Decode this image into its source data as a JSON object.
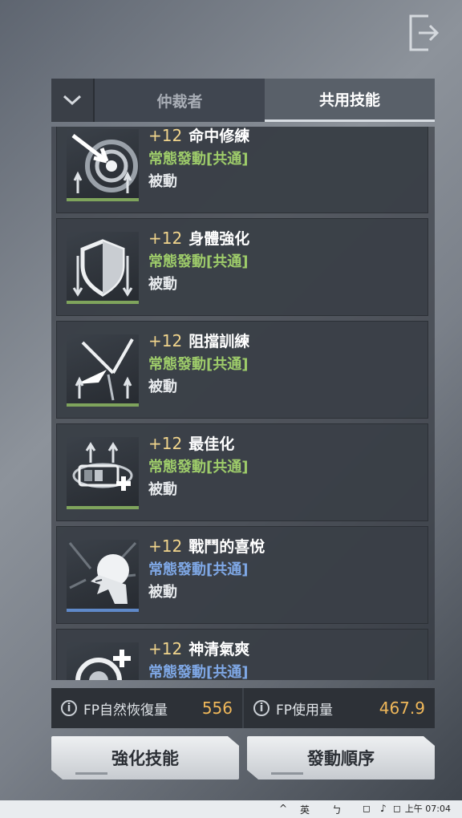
{
  "header": {
    "exit_icon": "exit-icon"
  },
  "tabs": {
    "dropdown_icon": "chevron-down-icon",
    "items": [
      {
        "label": "仲裁者",
        "active": false
      },
      {
        "label": "共用技能",
        "active": true
      }
    ]
  },
  "skills": [
    {
      "level": "+12",
      "name": "命中修練",
      "type": "常態發動[共通]",
      "sub": "被動",
      "icon": "target-arrow-icon",
      "color": "#9ecc6a"
    },
    {
      "level": "+12",
      "name": "身體強化",
      "type": "常態發動[共通]",
      "sub": "被動",
      "icon": "shield-icon",
      "color": "#9ecc6a"
    },
    {
      "level": "+12",
      "name": "阻擋訓練",
      "type": "常態發動[共通]",
      "sub": "被動",
      "icon": "block-blade-icon",
      "color": "#9ecc6a"
    },
    {
      "level": "+12",
      "name": "最佳化",
      "type": "常態發動[共通]",
      "sub": "被動",
      "icon": "battery-plus-icon",
      "color": "#9ecc6a"
    },
    {
      "level": "+12",
      "name": "戰鬥的喜悅",
      "type": "常態發動[共通]",
      "sub": "被動",
      "icon": "shouting-head-icon",
      "color": "#7fa8e6"
    },
    {
      "level": "+12",
      "name": "神清氣爽",
      "type": "常態發動[共通]",
      "sub": "",
      "icon": "refresh-plus-icon",
      "color": "#7fa8e6"
    }
  ],
  "stats": [
    {
      "label": "FP自然恢復量",
      "value": "556",
      "icon": "info-icon"
    },
    {
      "label": "FP使用量",
      "value": "467.9",
      "icon": "info-icon"
    }
  ],
  "buttons": {
    "enhance": "強化技能",
    "order": "發動順序"
  },
  "taskbar": {
    "time": "上午 07:04",
    "ime": "英",
    "items": [
      "^",
      "英",
      "ㄅ",
      "◻",
      "♪",
      "◻"
    ]
  }
}
